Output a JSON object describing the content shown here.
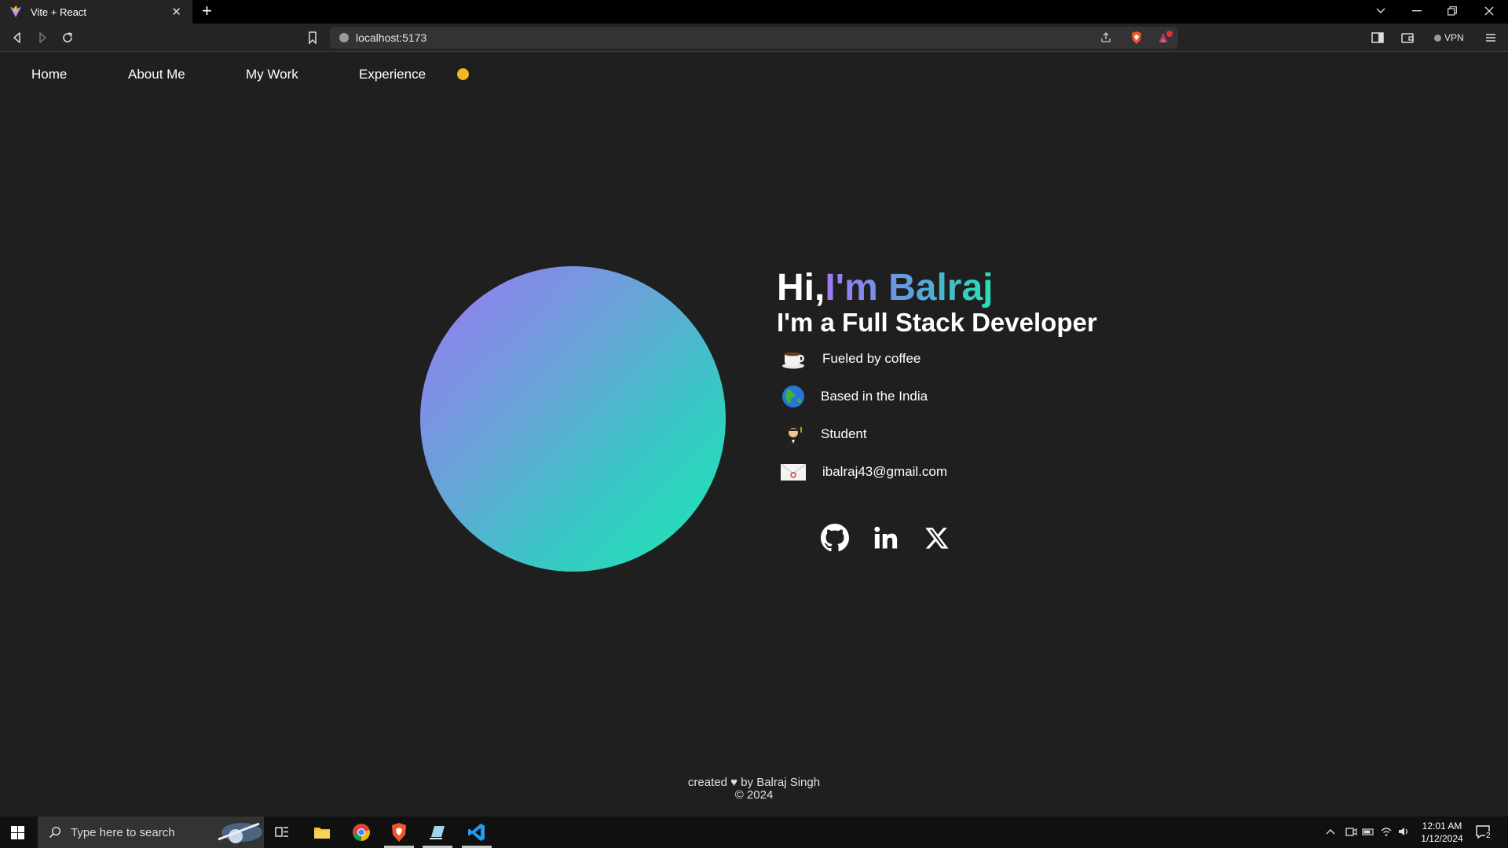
{
  "browser": {
    "tab_title": "Vite + React",
    "tab_close": "✕",
    "new_tab": "+",
    "url": "localhost:5173",
    "vpn_label": "VPN",
    "shields_badge": "1"
  },
  "nav": {
    "items": [
      {
        "label": "Home"
      },
      {
        "label": "About Me"
      },
      {
        "label": "My Work"
      },
      {
        "label": "Experience"
      }
    ],
    "theme_color": "#f2b723"
  },
  "hero": {
    "greeting": "Hi,",
    "name": "I'm Balraj",
    "role": "I'm a Full Stack Developer",
    "facts": [
      {
        "icon": "coffee-icon",
        "emoji": "☕",
        "text": "Fueled by coffee"
      },
      {
        "icon": "globe-icon",
        "emoji": "🌏",
        "text": "Based in the India"
      },
      {
        "icon": "student-icon",
        "emoji": "🧑‍🎓",
        "text": "Student"
      },
      {
        "icon": "email-icon",
        "emoji": "📧",
        "text": "ibalraj43@gmail.com"
      }
    ],
    "social": [
      "github-icon",
      "linkedin-icon",
      "x-icon"
    ]
  },
  "footer": {
    "line1": "created ♥ by Balraj Singh",
    "line2": "© 2024"
  },
  "taskbar": {
    "search_placeholder": "Type here to search",
    "time": "12:01 AM",
    "date": "1/12/2024",
    "notification_count": "2"
  },
  "colors": {
    "page_bg": "#1f1f1f",
    "gradient_start": "#9b77f5",
    "gradient_end": "#17ebb0"
  }
}
